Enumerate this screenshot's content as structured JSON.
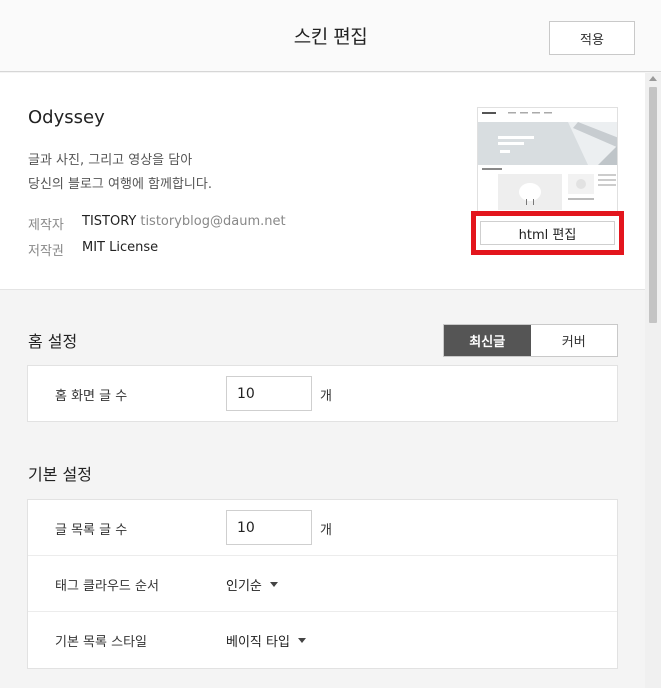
{
  "header": {
    "title": "스킨 편집",
    "apply_label": "적용"
  },
  "skin": {
    "name": "Odyssey",
    "description_line1": "글과 사진, 그리고 영상을 담아",
    "description_line2": "당신의 블로그 여행에 함께합니다.",
    "maker_label": "제작자",
    "maker_name": "TISTORY",
    "maker_email": "tistoryblog@daum.net",
    "license_label": "저작권",
    "license_value": "MIT License",
    "html_edit_label": "html 편집",
    "highlight_color": "#e3151d"
  },
  "home_settings": {
    "title": "홈 설정",
    "toggle": {
      "options": [
        "최신글",
        "커버"
      ],
      "selected": "최신글"
    },
    "rows": [
      {
        "label": "홈 화면 글 수",
        "value": "10",
        "unit": "개"
      }
    ]
  },
  "basic_settings": {
    "title": "기본 설정",
    "post_count": {
      "label": "글 목록 글 수",
      "value": "10",
      "unit": "개"
    },
    "tag_cloud_order": {
      "label": "태그 클라우드 순서",
      "value": "인기순"
    },
    "list_style": {
      "label": "기본 목록 스타일",
      "value": "베이직 타입"
    }
  }
}
